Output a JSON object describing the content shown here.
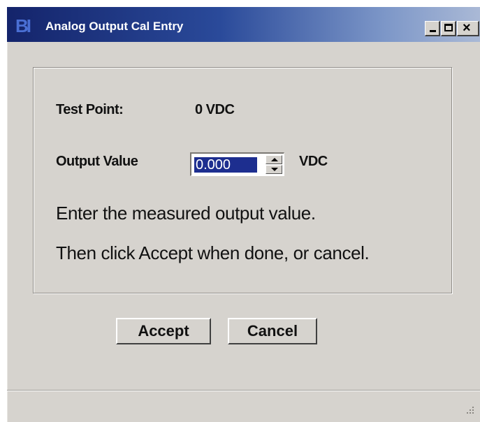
{
  "window": {
    "title": "Analog Output Cal Entry",
    "app_icon_text": "BI",
    "controls": {
      "minimize": "_",
      "maximize": "□",
      "close": "×"
    }
  },
  "form": {
    "test_point_label": "Test Point:",
    "test_point_value": "0 VDC",
    "output_value_label": "Output Value",
    "output_value": "0.000",
    "output_unit": "VDC",
    "instruction_line1": "Enter the measured output value.",
    "instruction_line2": "Then click Accept when done, or cancel."
  },
  "buttons": {
    "accept_label": "Accept",
    "cancel_label": "Cancel"
  },
  "colors": {
    "titlebar_start": "#14246b",
    "titlebar_end": "#aab9d6",
    "dialog_bg": "#d6d3ce",
    "selection": "#1d2e8f"
  }
}
